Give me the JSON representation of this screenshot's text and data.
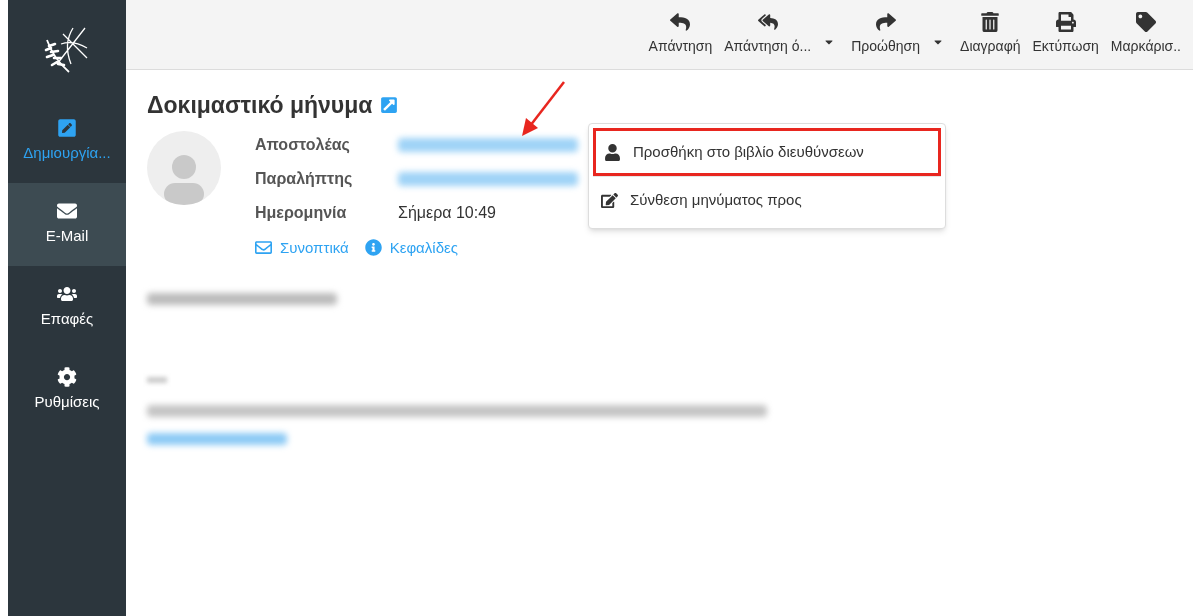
{
  "sidebar": {
    "items": [
      {
        "kind": "compose",
        "label": "Δημιουργία...",
        "selected": false
      },
      {
        "kind": "mail",
        "label": "E-Mail",
        "selected": true
      },
      {
        "kind": "contacts",
        "label": "Επαφές",
        "selected": false
      },
      {
        "kind": "settings",
        "label": "Ρυθμίσεις",
        "selected": false
      }
    ]
  },
  "toolbar": [
    {
      "kind": "reply",
      "label": "Απάντηση",
      "dropdown": false
    },
    {
      "kind": "reply-all",
      "label": "Απάντηση ό...",
      "dropdown": true
    },
    {
      "kind": "forward",
      "label": "Προώθηση",
      "dropdown": true
    },
    {
      "kind": "delete",
      "label": "Διαγραφή",
      "dropdown": false
    },
    {
      "kind": "print",
      "label": "Εκτύπωση",
      "dropdown": false
    },
    {
      "kind": "tag",
      "label": "Μαρκάρισ..",
      "dropdown": false
    }
  ],
  "message": {
    "subject": "Δοκιμαστικό μήνυμα",
    "fields": [
      {
        "kind": "blurred",
        "label": "Αποστολέας"
      },
      {
        "kind": "blurred",
        "label": "Παραλήπτης"
      },
      {
        "kind": "text",
        "label": "Ημερομηνία",
        "value": "Σήμερα 10:49"
      }
    ],
    "links": [
      {
        "kind": "envelope",
        "label": "Συνοπτικά"
      },
      {
        "kind": "info",
        "label": "Κεφαλίδες"
      }
    ]
  },
  "popup_menu": {
    "items": [
      {
        "kind": "person",
        "label": "Προσθήκη στο βιβλίο διευθύνσεων",
        "highlighted": true
      },
      {
        "kind": "edit",
        "label": "Σύνθεση μηνύματος προς",
        "highlighted": false
      }
    ]
  }
}
